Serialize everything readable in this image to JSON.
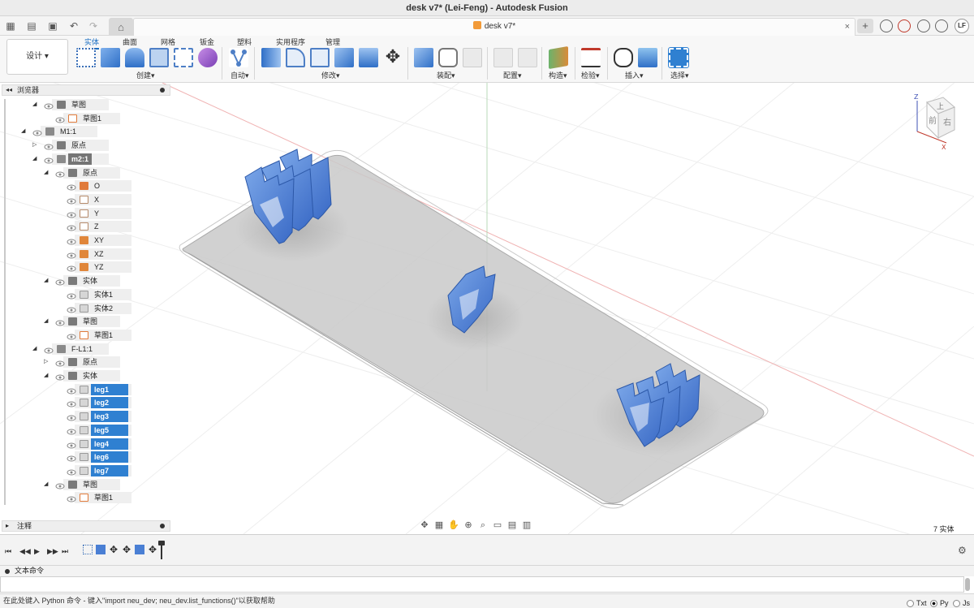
{
  "window": {
    "title": "desk v7* (Lei-Feng) - Autodesk Fusion"
  },
  "tabs": {
    "document": "desk v7*",
    "close": "×",
    "add": "+"
  },
  "user": {
    "initials": "LF"
  },
  "ribbon": {
    "workspace": "设计 ▾",
    "tabs": [
      "实体",
      "曲面",
      "网格",
      "钣金",
      "塑料",
      "实用程序",
      "管理"
    ],
    "groups": {
      "create": "创建▾",
      "automate": "自动▾",
      "modify": "修改▾",
      "assemble": "装配▾",
      "configure": "配置▾",
      "construct": "构造▾",
      "inspect": "检验▾",
      "insert": "插入▾",
      "select": "选择▾"
    }
  },
  "browser": {
    "title": "浏览器",
    "items": [
      {
        "label": "草图",
        "level": 3,
        "expander": "◢",
        "kind": "folder",
        "state": "normal"
      },
      {
        "label": "草图1",
        "level": 4,
        "expander": "",
        "kind": "sketch",
        "state": "normal"
      },
      {
        "label": "M1:1",
        "level": 2,
        "expander": "◢",
        "kind": "component",
        "state": "normal"
      },
      {
        "label": "原点",
        "level": 3,
        "expander": "▷",
        "kind": "folder",
        "state": "normal"
      },
      {
        "label": "m2:1",
        "level": 3,
        "expander": "◢",
        "kind": "component",
        "state": "dark"
      },
      {
        "label": "原点",
        "level": 4,
        "expander": "◢",
        "kind": "folder",
        "state": "normal"
      },
      {
        "label": "O",
        "level": 5,
        "expander": "",
        "kind": "origin",
        "state": "normal"
      },
      {
        "label": "X",
        "level": 5,
        "expander": "",
        "kind": "axis",
        "state": "normal"
      },
      {
        "label": "Y",
        "level": 5,
        "expander": "",
        "kind": "axis",
        "state": "normal"
      },
      {
        "label": "Z",
        "level": 5,
        "expander": "",
        "kind": "axis",
        "state": "normal"
      },
      {
        "label": "XY",
        "level": 5,
        "expander": "",
        "kind": "plane",
        "state": "normal"
      },
      {
        "label": "XZ",
        "level": 5,
        "expander": "",
        "kind": "plane",
        "state": "normal"
      },
      {
        "label": "YZ",
        "level": 5,
        "expander": "",
        "kind": "plane",
        "state": "normal"
      },
      {
        "label": "实体",
        "level": 4,
        "expander": "◢",
        "kind": "folder",
        "state": "normal"
      },
      {
        "label": "实体1",
        "level": 5,
        "expander": "",
        "kind": "body",
        "state": "normal"
      },
      {
        "label": "实体2",
        "level": 5,
        "expander": "",
        "kind": "body",
        "state": "normal"
      },
      {
        "label": "草图",
        "level": 4,
        "expander": "◢",
        "kind": "folder",
        "state": "normal"
      },
      {
        "label": "草图1",
        "level": 5,
        "expander": "",
        "kind": "sketch",
        "state": "normal"
      },
      {
        "label": "F-L1:1",
        "level": 3,
        "expander": "◢",
        "kind": "component",
        "state": "normal"
      },
      {
        "label": "原点",
        "level": 4,
        "expander": "▷",
        "kind": "folder",
        "state": "normal"
      },
      {
        "label": "实体",
        "level": 4,
        "expander": "◢",
        "kind": "folder",
        "state": "normal"
      },
      {
        "label": "leg1",
        "level": 5,
        "expander": "",
        "kind": "body",
        "state": "selected"
      },
      {
        "label": "leg2",
        "level": 5,
        "expander": "",
        "kind": "body",
        "state": "selected"
      },
      {
        "label": "leg3",
        "level": 5,
        "expander": "",
        "kind": "body",
        "state": "selected"
      },
      {
        "label": "leg5",
        "level": 5,
        "expander": "",
        "kind": "body",
        "state": "selected"
      },
      {
        "label": "leg4",
        "level": 5,
        "expander": "",
        "kind": "body",
        "state": "selected"
      },
      {
        "label": "leg6",
        "level": 5,
        "expander": "",
        "kind": "body",
        "state": "selected"
      },
      {
        "label": "leg7",
        "level": 5,
        "expander": "",
        "kind": "body",
        "state": "selected"
      },
      {
        "label": "草图",
        "level": 4,
        "expander": "◢",
        "kind": "folder",
        "state": "normal"
      },
      {
        "label": "草图1",
        "level": 5,
        "expander": "",
        "kind": "sketch",
        "state": "normal"
      }
    ]
  },
  "notes": {
    "title": "注释"
  },
  "viewcube": {
    "top": "上",
    "front": "前",
    "right": "右",
    "z": "Z",
    "x": "X"
  },
  "viewport": {
    "body_count": "7 实体"
  },
  "text_command": {
    "title": "文本命令",
    "hint": "在此处键入 Python 命令 - 键入\"import neu_dev; neu_dev.list_functions()\"以获取帮助",
    "langs": [
      {
        "label": "Txt",
        "on": false
      },
      {
        "label": "Py",
        "on": true
      },
      {
        "label": "Js",
        "on": false
      }
    ]
  },
  "colors": {
    "accent": "#1c6fc2",
    "selection": "#2f80d1",
    "leg_blue": "#4a7fd4"
  }
}
